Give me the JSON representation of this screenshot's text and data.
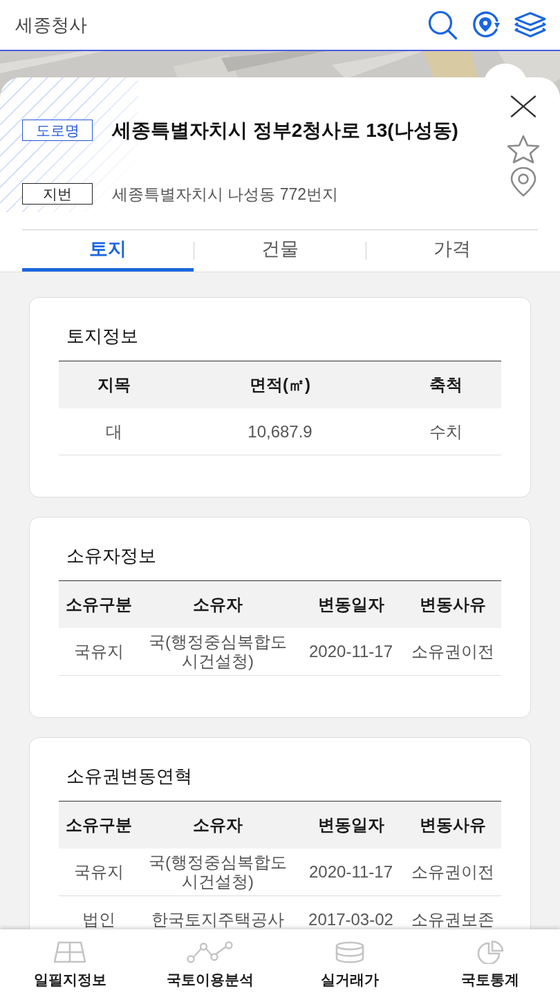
{
  "header": {
    "title": "세종청사"
  },
  "place": {
    "addresses": [
      {
        "kind": "road",
        "tag": "도로명",
        "text": "세종특별자치시 정부2청사로 13(나성동)"
      },
      {
        "kind": "lot",
        "tag": "지번",
        "text": "세종특별자치시 나성동 772번지"
      }
    ]
  },
  "tabs": [
    {
      "label": "토지",
      "selected": true
    },
    {
      "label": "건물",
      "selected": false
    },
    {
      "label": "가격",
      "selected": false
    }
  ],
  "sections": [
    {
      "title": "토지정보",
      "columns": [
        "지목",
        "면적(㎡)",
        "축척"
      ],
      "rows": [
        [
          "대",
          "10,687.9",
          "수치"
        ]
      ]
    },
    {
      "title": "소유자정보",
      "columns": [
        "소유구분",
        "소유자",
        "변동일자",
        "변동사유"
      ],
      "rows": [
        [
          "국유지",
          "국(행정중심복합도시건설청)",
          "2020-11-17",
          "소유권이전"
        ]
      ]
    },
    {
      "title": "소유권변동연혁",
      "columns": [
        "소유구분",
        "소유자",
        "변동일자",
        "변동사유"
      ],
      "rows": [
        [
          "국유지",
          "국(행정중심복합도시건설청)",
          "2020-11-17",
          "소유권이전"
        ],
        [
          "법인",
          "한국토지주택공사",
          "2017-03-02",
          "소유권보존"
        ]
      ]
    }
  ],
  "bottom_nav": [
    {
      "label": "일필지정보"
    },
    {
      "label": "국토이용분석"
    },
    {
      "label": "실거래가"
    },
    {
      "label": "국토통계"
    }
  ]
}
